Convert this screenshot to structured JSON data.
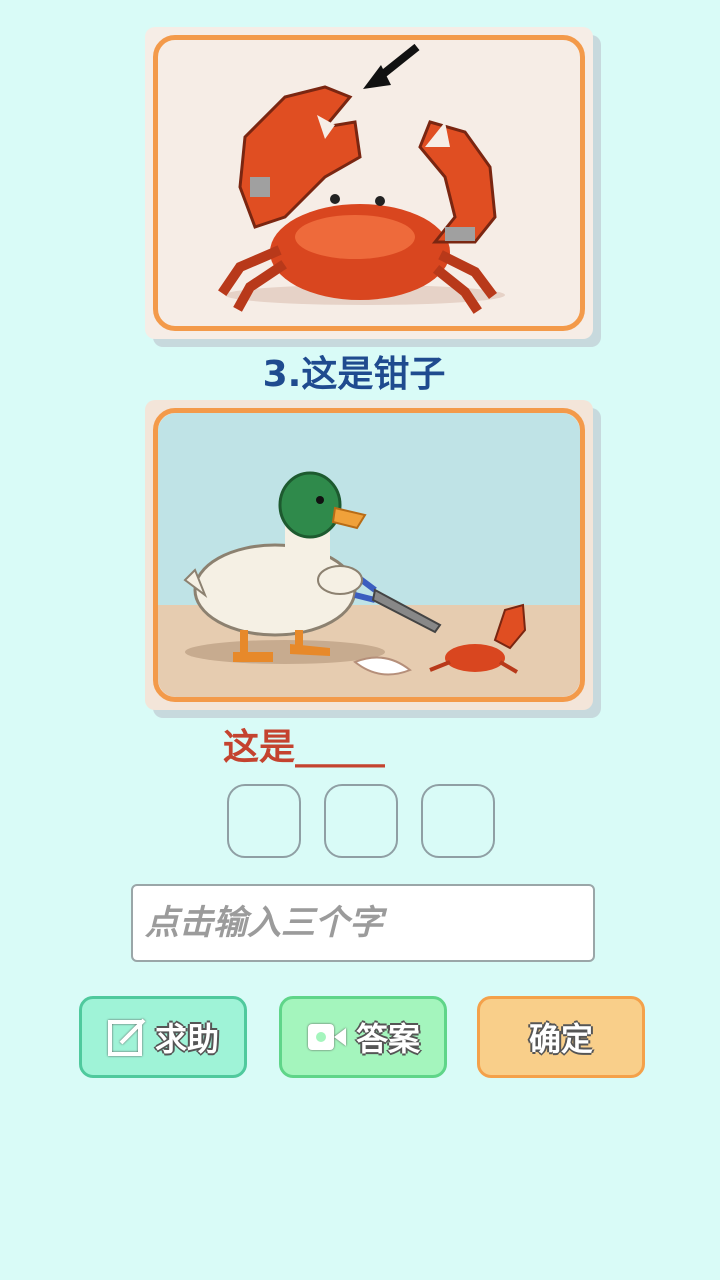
{
  "question": {
    "number_title": "3.这是钳子",
    "prompt": "这是_____"
  },
  "answer_slots": [
    "",
    "",
    ""
  ],
  "input": {
    "placeholder": "点击输入三个字",
    "value": ""
  },
  "buttons": {
    "help": {
      "label": "求助",
      "icon": "edit-icon"
    },
    "answer": {
      "label": "答案",
      "icon": "video-camera-icon"
    },
    "confirm": {
      "label": "确定"
    }
  },
  "colors": {
    "background": "#d9fbf7",
    "card_border": "#f39a4a",
    "title_blue": "#1f4b8f",
    "prompt_red": "#c4432f",
    "help_button": "#9ff3d7",
    "answer_button": "#a4f5bd",
    "confirm_button": "#f9cf8a"
  },
  "images": {
    "top": "pixel-art-crab-claw-image",
    "bottom": "pixel-art-duck-with-pliers-and-crab-image"
  }
}
